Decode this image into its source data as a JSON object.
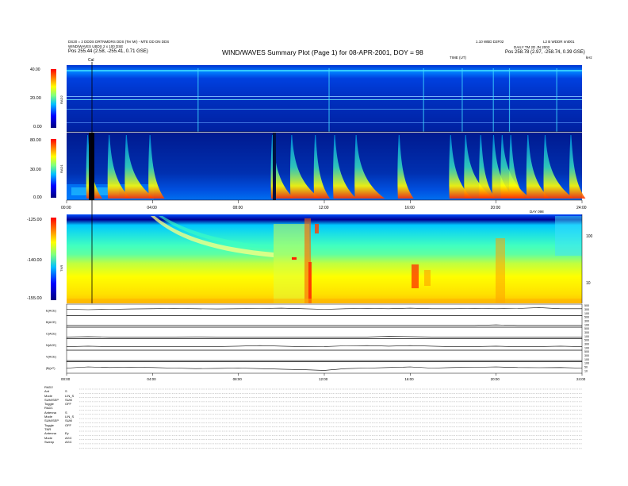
{
  "header": {
    "left_line1": "DS20 = 2 DDDS DRTNMDRS DDS (Ter Mr) - MTE DD DN DDS",
    "left_line2": "WIND/WAVES UBDS 2 x 100 DSE",
    "left_pos_label": "Pos",
    "left_pos_value": "255.44 (2.58, -255.41, 0.71 GSE)",
    "title": "WIND/WAVES Summary Plot (Page 1) for 08-APR-2001, DOY = 98",
    "right_line1": "1.10 WBD D2F02",
    "right_line2": "L2 B WDDR nnt001",
    "right_line3": "DAILY TM 2D JN 2002",
    "right_pos_label": "Pos",
    "right_pos_value": "258.78 (2.97, -258.74, 0.39 GSE)",
    "time_label": "TIME (UT)",
    "khz_label": "kHz"
  },
  "chart_data": [
    {
      "type": "heatmap",
      "panel": "RAD2",
      "ylabel": "RAD2",
      "colorbar_ticks": [
        "40.00",
        "20.00",
        "0.00"
      ],
      "cal_label": "Cal",
      "xlim": [
        0,
        24
      ],
      "colormap": [
        "#00007f",
        "#0000ff",
        "#00bfff",
        "#7fff7f",
        "#ffff00",
        "#ff7f00",
        "#ff0000"
      ]
    },
    {
      "type": "heatmap",
      "panel": "RAD1",
      "ylabel": "RAD1",
      "colorbar_ticks": [
        "80.00",
        "30.00",
        "0.00"
      ],
      "x_tick_labels": [
        "00:00",
        "04:00",
        "08:00",
        "12:00",
        "16:00",
        "20:00",
        "24:00"
      ],
      "bursts_hours": [
        1.0,
        2.0,
        2.8,
        3.9,
        9.6,
        10.5,
        11.6,
        12.5,
        13.5,
        15.5,
        17.9,
        18.6,
        19.3,
        19.9,
        20.3,
        20.7,
        21.5,
        22.3,
        23.5
      ],
      "xlim": [
        0,
        24
      ]
    },
    {
      "type": "heatmap",
      "panel": "TNR",
      "ylabel": "TNR",
      "colorbar_ticks": [
        "-125.00",
        "-140.00",
        "-155.00"
      ],
      "right_axis_ticks": [
        "100",
        "10"
      ],
      "right_axis_label": "kHz",
      "x_label_top": "DAY 098",
      "xlim": [
        0,
        24
      ]
    },
    {
      "type": "line",
      "panel": "ACE",
      "ylabel": "E(ACE)",
      "right_ticks": [
        "500",
        "300",
        "100"
      ],
      "values": [
        0.55,
        0.52,
        0.55,
        0.58,
        0.6,
        0.62,
        0.6,
        0.58,
        0.6,
        0.62,
        0.65,
        0.6,
        0.55,
        0.6,
        0.62,
        0.6,
        0.65,
        0.6,
        0.6,
        0.62,
        0.6,
        0.62,
        0.7,
        0.6,
        0.6
      ]
    },
    {
      "type": "line",
      "panel": "ACE-B",
      "ylabel": "B(ACE)",
      "right_ticks": [
        "500",
        "300",
        "100"
      ],
      "values": [
        0.15,
        0.15,
        0.15,
        0.15,
        0.15,
        0.15,
        0.15,
        0.15,
        0.15,
        0.15,
        0.15,
        0.15,
        0.15,
        0.15,
        0.15,
        0.15,
        0.15,
        0.15,
        0.15,
        0.15,
        0.2,
        0.15,
        0.15,
        0.15,
        0.15
      ]
    },
    {
      "type": "line",
      "panel": "ACE-C",
      "ylabel": "C(ACE)",
      "right_ticks": [
        "500",
        "300",
        "100"
      ],
      "values": [
        0.15,
        0.18,
        0.15,
        0.15,
        0.15,
        0.15,
        0.16,
        0.15,
        0.15,
        0.15,
        0.15,
        0.15,
        0.15,
        0.15,
        0.15,
        0.2,
        0.18,
        0.15,
        0.15,
        0.15,
        0.15,
        0.15,
        0.15,
        0.15,
        0.15
      ]
    },
    {
      "type": "line",
      "panel": "ACE-N",
      "ylabel": "N(ACE)",
      "right_ticks": [
        "500",
        "300",
        "100"
      ],
      "values": [
        0.3,
        0.35,
        0.3,
        0.32,
        0.3,
        0.32,
        0.3,
        0.32,
        0.35,
        0.4,
        0.35,
        0.3,
        0.32,
        0.38,
        0.4,
        0.35,
        0.4,
        0.35,
        0.3,
        0.32,
        0.35,
        0.3,
        0.32,
        0.35,
        0.3
      ]
    },
    {
      "type": "line",
      "panel": "ACE-V",
      "ylabel": "V(ACE)",
      "right_ticks": [
        "500",
        "300",
        "100"
      ],
      "values": [
        0.1,
        0.1,
        0.1,
        0.1,
        0.1,
        0.1,
        0.1,
        0.1,
        0.1,
        0.1,
        0.1,
        0.1,
        0.1,
        0.1,
        0.1,
        0.1,
        0.1,
        0.1,
        0.1,
        0.1,
        0.1,
        0.1,
        0.1,
        0.1,
        0.1
      ]
    },
    {
      "type": "line",
      "panel": "BT",
      "ylabel": "|B|(nT)",
      "right_ticks": [
        "100",
        "50",
        "10"
      ],
      "values": [
        0.45,
        0.55,
        0.5,
        0.52,
        0.5,
        0.45,
        0.4,
        0.42,
        0.45,
        0.4,
        0.35,
        0.3,
        0.25,
        0.4,
        0.45,
        0.5,
        0.55,
        0.45,
        0.5,
        0.52,
        0.55,
        0.5,
        0.48,
        0.5,
        0.45
      ],
      "x_tick_labels": [
        "00:00",
        "04:00",
        "08:00",
        "12:00",
        "16:00",
        "20:00",
        "24:00"
      ]
    }
  ],
  "settings": {
    "rad2_heading": "RAD2",
    "rad2_rows": [
      [
        "Ant",
        "S"
      ],
      [
        "Mode",
        "LIN_S"
      ],
      [
        "SUM/SEP",
        "SUM"
      ],
      [
        "Toggle",
        "OFF"
      ]
    ],
    "rad1_heading": "RAD1",
    "rad1_rows": [
      [
        "Antenna",
        "S"
      ],
      [
        "Mode",
        "LIN_S"
      ],
      [
        "SUM/SEP",
        "SUM"
      ],
      [
        "Toggle",
        "OFF"
      ]
    ],
    "tnr_heading": "TNR",
    "tnr_rows": [
      [
        "Antenna",
        "Ey"
      ],
      [
        "Mode",
        "AGC"
      ],
      [
        "Sweep",
        "AGC"
      ]
    ]
  }
}
